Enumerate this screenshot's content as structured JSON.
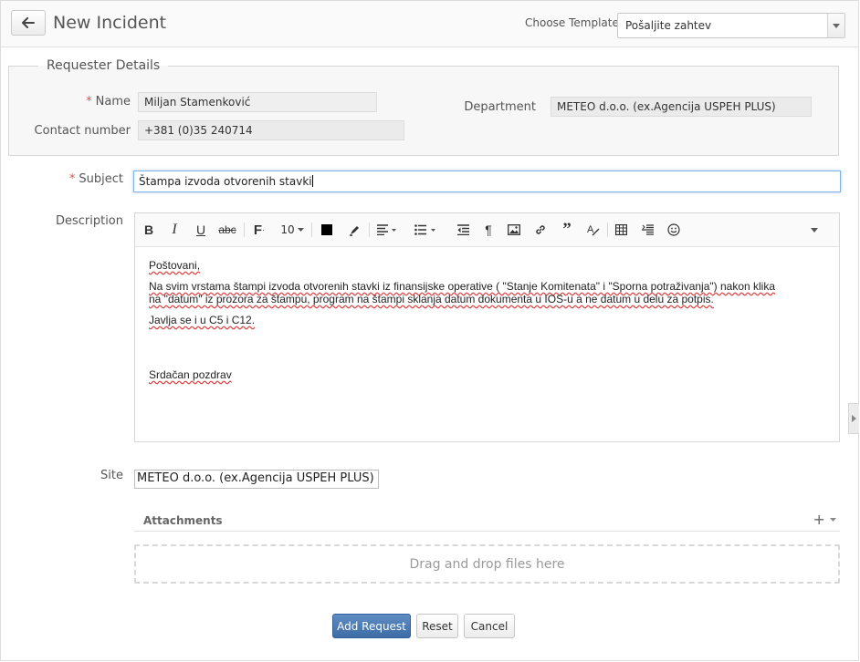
{
  "header": {
    "title": "New Incident",
    "template_label": "Choose Template",
    "template_value": "Pošaljite zahtev"
  },
  "requester": {
    "legend": "Requester Details",
    "name_label": "Name",
    "name_value": "Miljan Stamenković",
    "contact_label": "Contact number",
    "contact_value": "+381 (0)35 240714",
    "department_label": "Department",
    "department_value": "METEO d.o.o. (ex.Agencija USPEH PLUS)"
  },
  "subject": {
    "label": "Subject",
    "value": "Štampa izvoda otvorenih stavki"
  },
  "description": {
    "label": "Description",
    "toolbar": {
      "font_size": "10"
    },
    "greeting": "Poštovani,",
    "body_line1": "Na svim vrstama štampi izvoda otvorenih stavki iz finansijske operative ( \"Stanje Komitenata\" i \"Sporna potraživanja\") nakon klika",
    "body_line2": "na \"datum\" iz prozora za štampu, program na štampi sklanja datum dokumenta u IOS-u a ne datum u delu za potpis.",
    "body_line3": "Javlja se i u C5 i C12.",
    "closing": "Srdačan pozdrav"
  },
  "site": {
    "label": "Site",
    "value": "METEO d.o.o. (ex.Agencija USPEH PLUS)"
  },
  "attachments": {
    "title": "Attachments",
    "dropzone_text": "Drag and drop files here"
  },
  "actions": {
    "add_label": "Add Request",
    "reset_label": "Reset",
    "cancel_label": "Cancel"
  },
  "colors": {
    "primary": "#4a78b0",
    "required": "#d9534f",
    "focus": "#7fb3e3"
  }
}
